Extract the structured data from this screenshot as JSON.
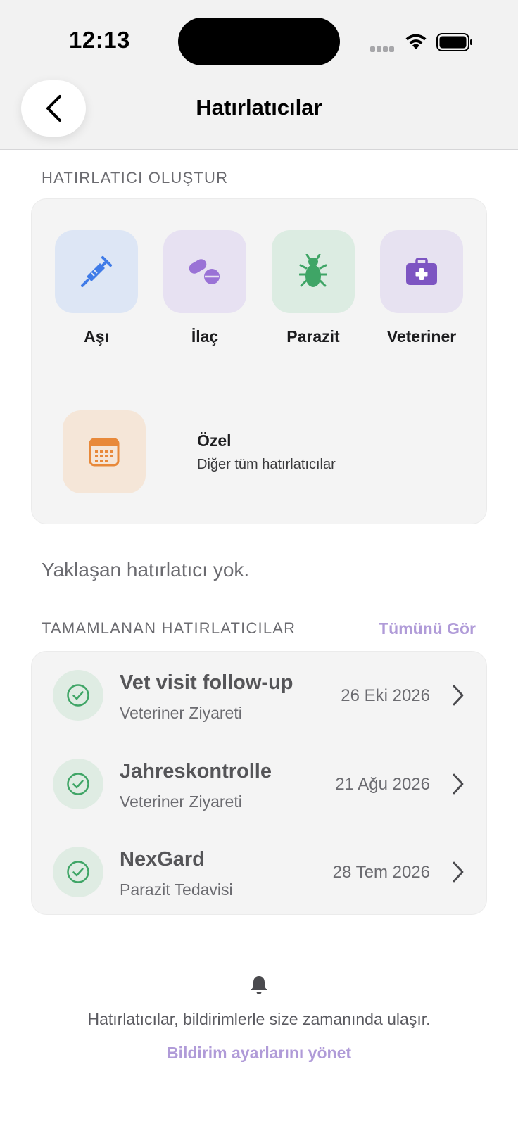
{
  "status_bar": {
    "time": "12:13"
  },
  "header": {
    "title": "Hatırlatıcılar"
  },
  "create_section": {
    "heading": "HATIRLATICI OLUŞTUR",
    "types": [
      {
        "label": "Aşı",
        "icon": "syringe-icon",
        "bg": "#dde6f5",
        "color": "#3f7be8"
      },
      {
        "label": "İlaç",
        "icon": "pills-icon",
        "bg": "#e7e1f2",
        "color": "#9a72d6"
      },
      {
        "label": "Parazit",
        "icon": "bug-icon",
        "bg": "#dcece2",
        "color": "#3fa566"
      },
      {
        "label": "Veteriner",
        "icon": "medkit-icon",
        "bg": "#e7e2f1",
        "color": "#7d55c2"
      }
    ],
    "custom": {
      "title": "Özel",
      "subtitle": "Diğer tüm hatırlatıcılar",
      "icon": "calendar-icon",
      "bg": "#f5e6d8",
      "color": "#e8893a"
    }
  },
  "upcoming": {
    "empty_text": "Yaklaşan hatırlatıcı yok."
  },
  "completed": {
    "heading": "TAMAMLANAN HATIRLATICILAR",
    "see_all": "Tümünü Gör",
    "items": [
      {
        "title": "Vet visit follow-up",
        "subtitle": "Veteriner Ziyareti",
        "date": "26 Eki 2026"
      },
      {
        "title": "Jahreskontrolle",
        "subtitle": "Veteriner Ziyareti",
        "date": "21 Ağu 2026"
      },
      {
        "title": "NexGard",
        "subtitle": "Parazit Tedavisi",
        "date": "28 Tem 2026"
      }
    ]
  },
  "footer": {
    "text": "Hatırlatıcılar, bildirimlerle size zamanında ulaşır.",
    "link": "Bildirim ayarlarını yönet"
  },
  "colors": {
    "accent": "#b09bd8",
    "success": "#3fa566",
    "success_bg": "#dfece3"
  }
}
